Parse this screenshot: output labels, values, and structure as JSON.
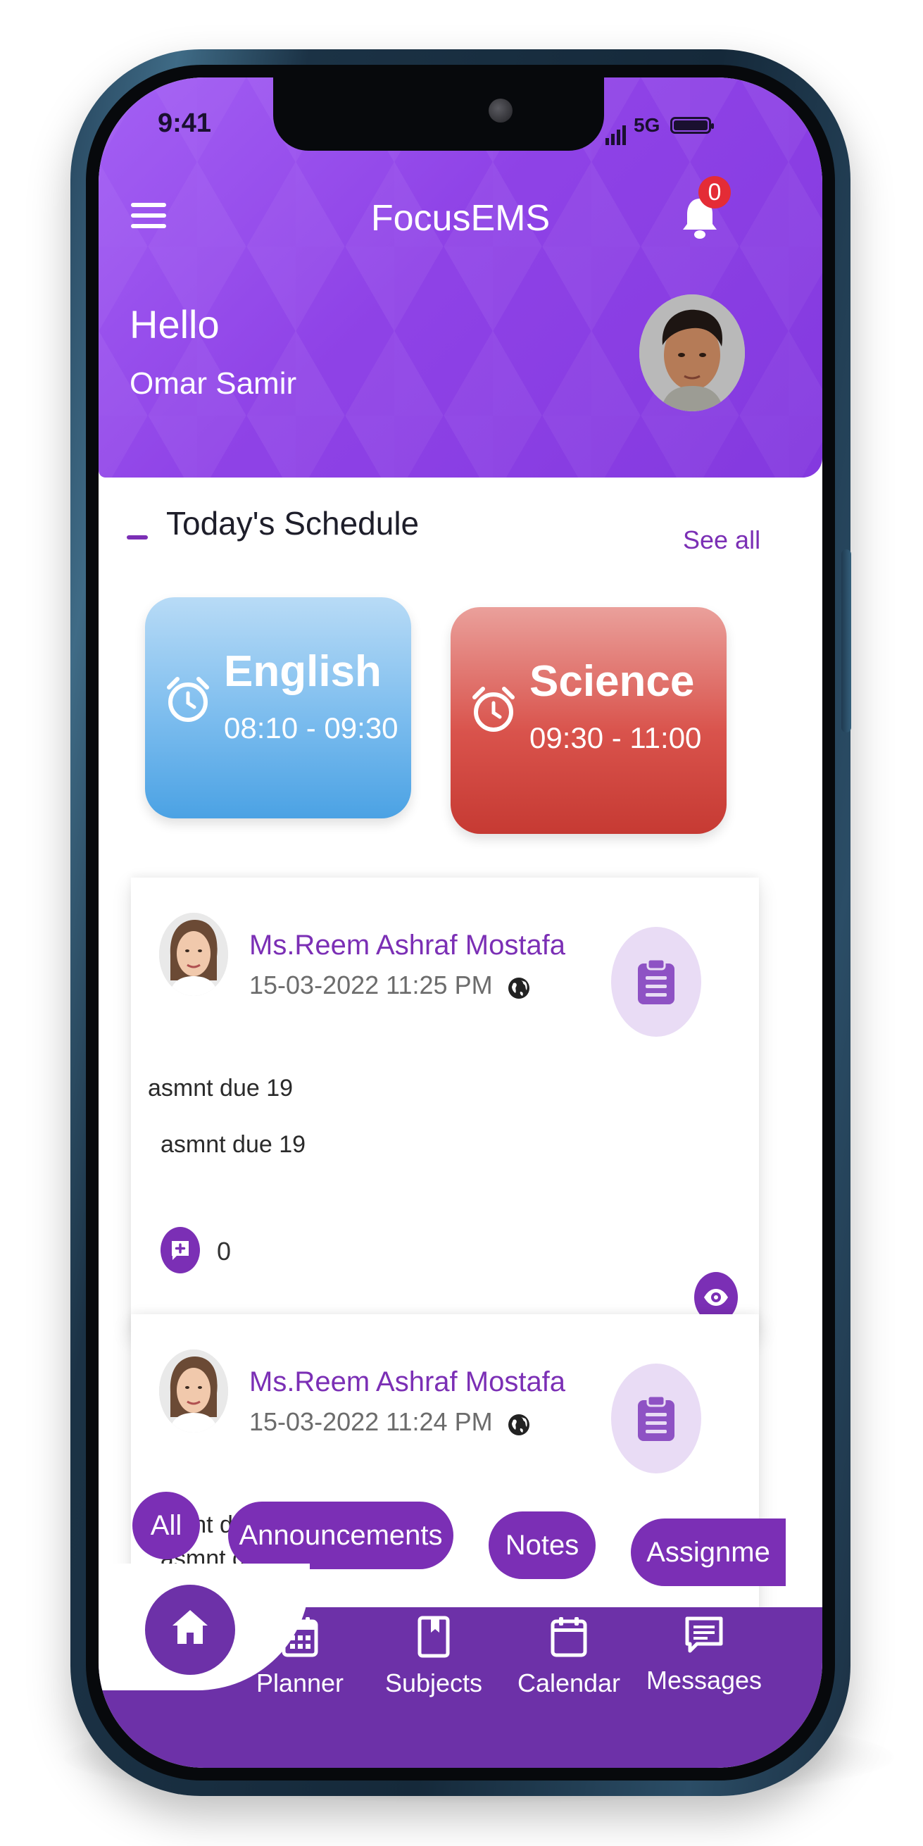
{
  "status_bar": {
    "time": "9:41",
    "network": "5G"
  },
  "header": {
    "title": "FocusEMS",
    "notification_count": "0",
    "greeting": "Hello",
    "user_name": "Omar Samir"
  },
  "schedule": {
    "title": "Today's Schedule",
    "see_all": "See all",
    "items": [
      {
        "subject": "English",
        "time": "08:10 - 09:30",
        "color": "#5aaee8"
      },
      {
        "subject": "Science",
        "time": "09:30 - 11:00",
        "color": "#d4463f"
      }
    ]
  },
  "posts": [
    {
      "author": "Ms.Reem Ashraf Mostafa",
      "date": "15-03-2022 11:25 PM",
      "line1": "asmnt due 19",
      "line2": "asmnt due 19",
      "comments": "0"
    },
    {
      "author": "Ms.Reem Ashraf Mostafa",
      "date": "15-03-2022 11:24 PM",
      "line1": "asmnt d",
      "line2": "asmnt due 18"
    }
  ],
  "filters": [
    "All",
    "Announcements",
    "Notes",
    "Assignme"
  ],
  "bottom_nav": {
    "items": [
      {
        "label": "Planner",
        "icon": "planner-icon"
      },
      {
        "label": "Subjects",
        "icon": "subjects-icon"
      },
      {
        "label": "Calendar",
        "icon": "calendar-icon"
      },
      {
        "label": "Messages",
        "icon": "messages-icon"
      }
    ]
  },
  "colors": {
    "brand_purple": "#7b2fb5",
    "header_purple": "#8f42e6",
    "nav_purple": "#6d31a8",
    "badge_red": "#e42c36"
  }
}
